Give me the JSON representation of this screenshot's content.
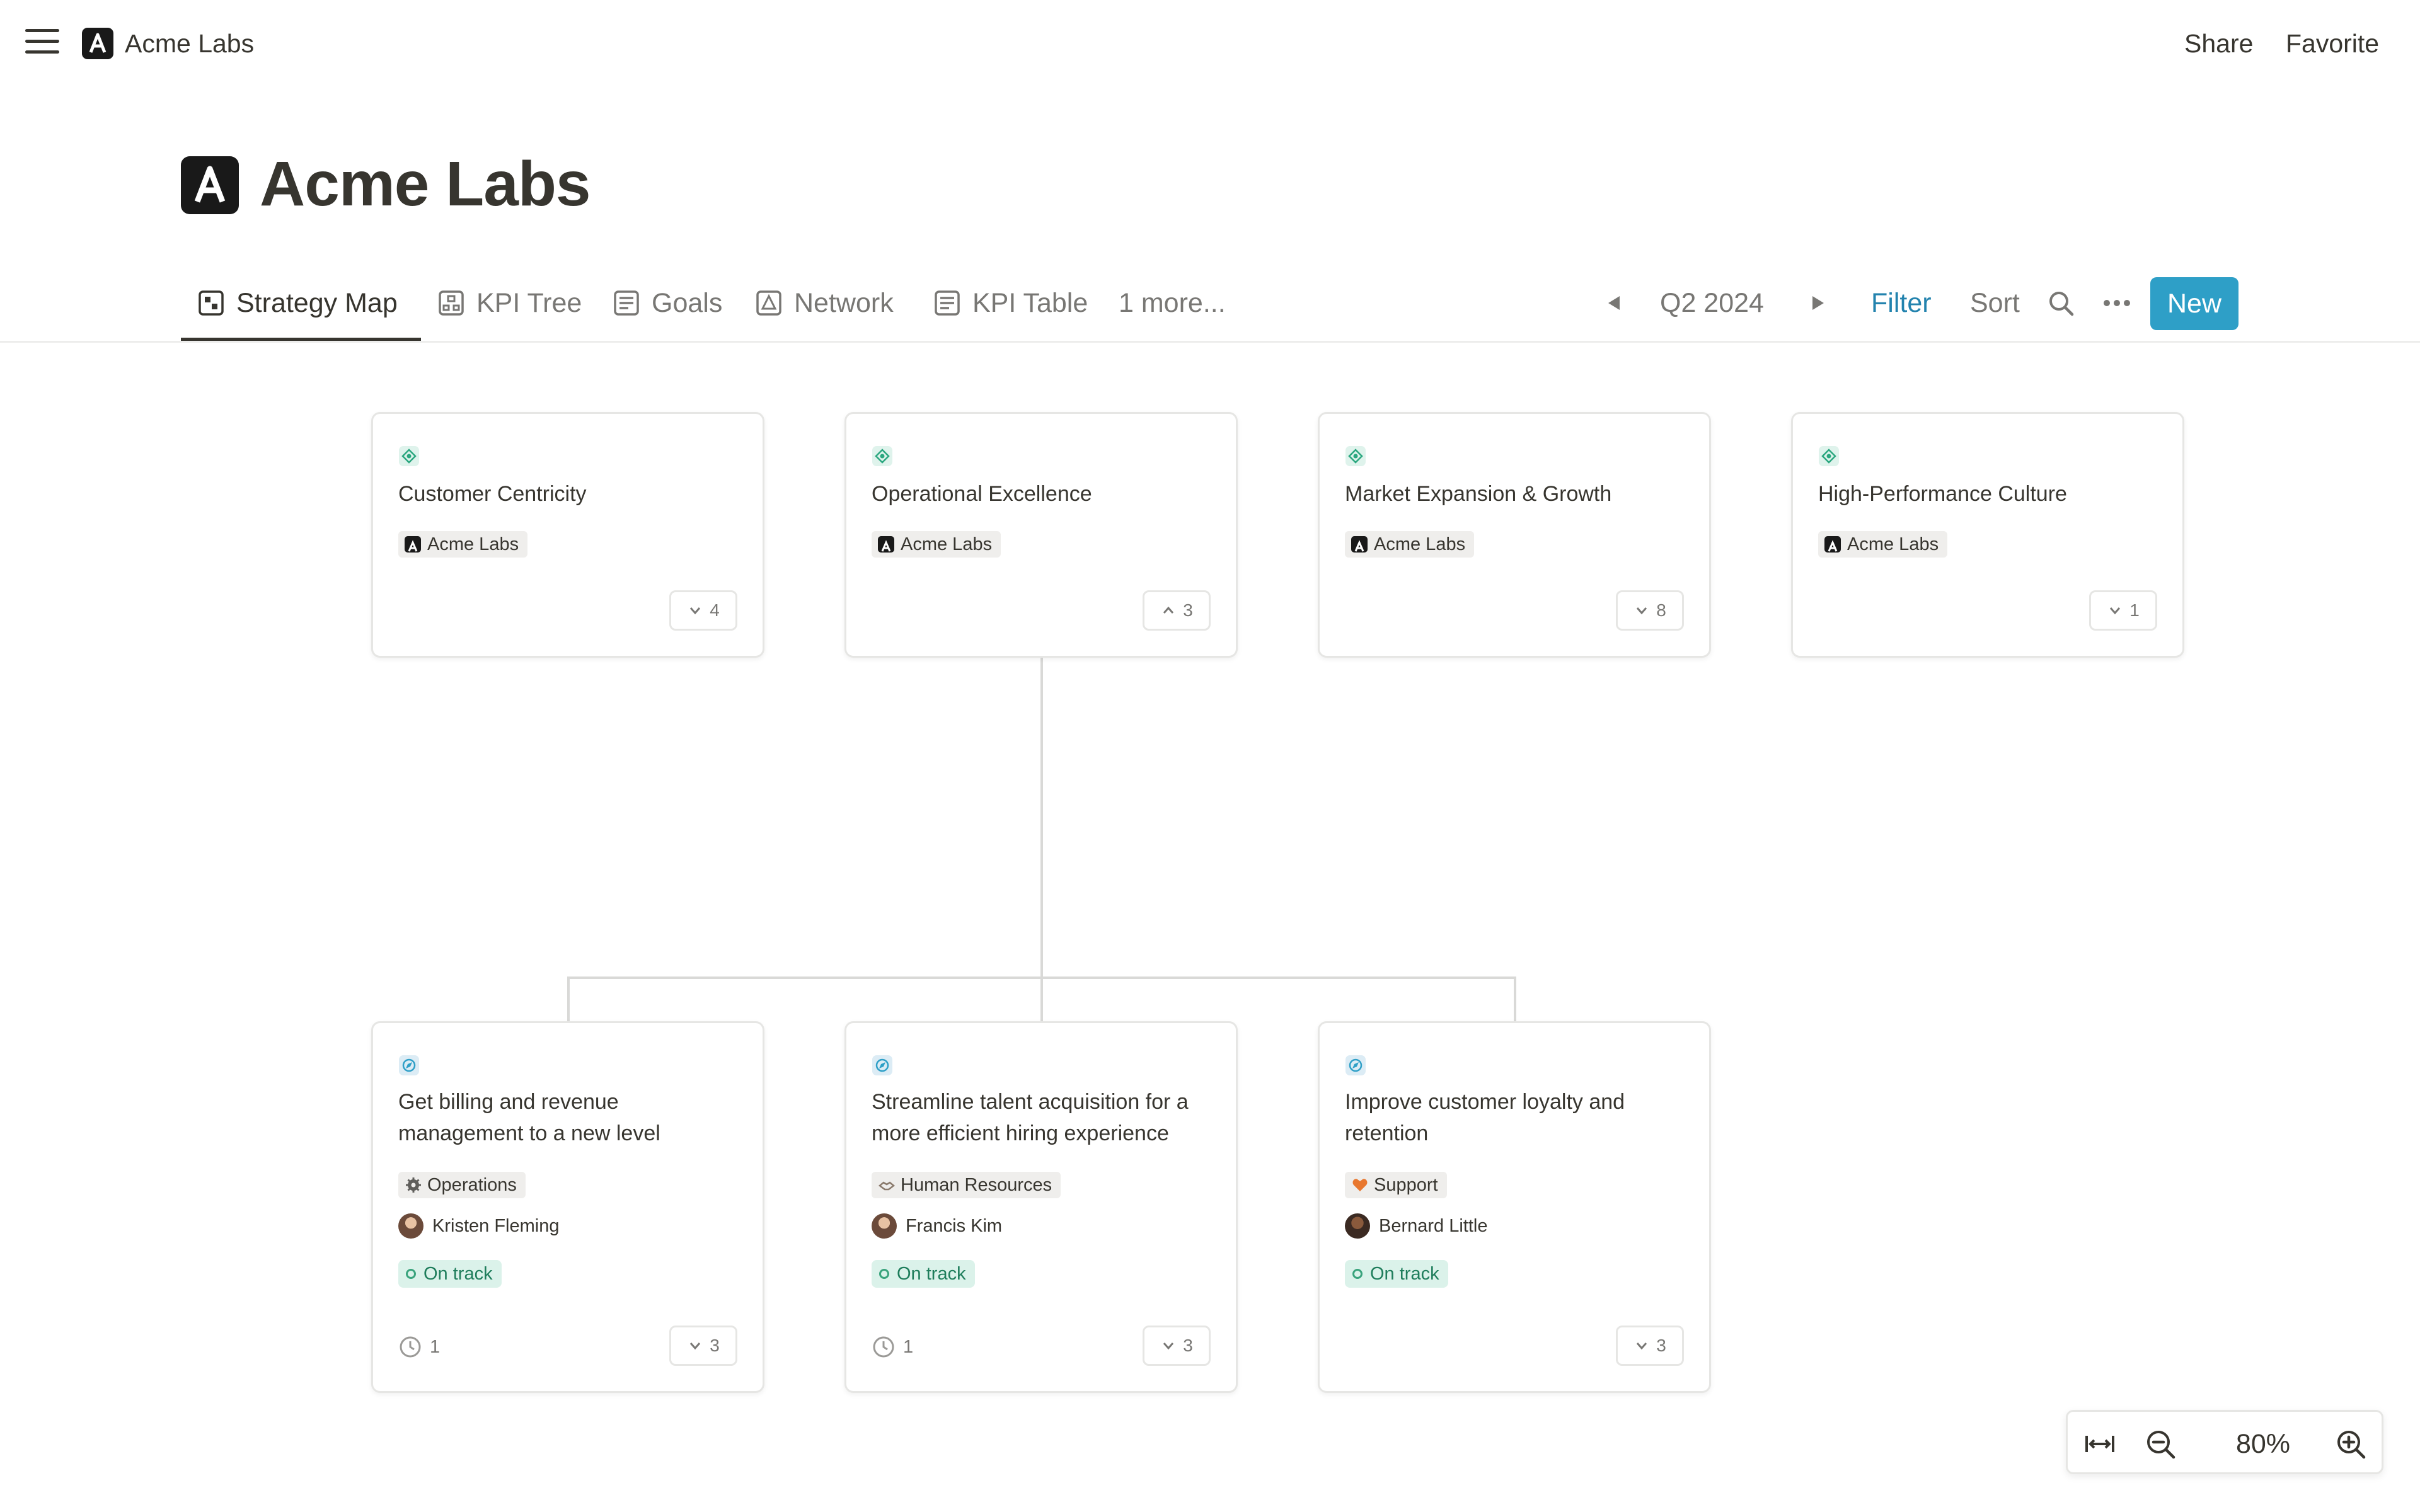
{
  "topbar": {
    "workspace_name": "Acme Labs",
    "share_label": "Share",
    "favorite_label": "Favorite"
  },
  "page": {
    "title": "Acme Labs",
    "logo_letter": "A"
  },
  "tabs": [
    {
      "label": "Strategy Map",
      "icon": "board-icon",
      "active": true
    },
    {
      "label": "KPI Tree",
      "icon": "tree-icon"
    },
    {
      "label": "Goals",
      "icon": "list-icon"
    },
    {
      "label": "Network",
      "icon": "network-icon"
    },
    {
      "label": "KPI Table",
      "icon": "table-icon"
    },
    {
      "label": "1 more..."
    }
  ],
  "controls": {
    "period": "Q2 2024",
    "filter_label": "Filter",
    "sort_label": "Sort",
    "new_label": "New",
    "accent_color": "#2e9fc7"
  },
  "objectives": [
    {
      "title": "Customer Centricity",
      "tag": "Acme Labs",
      "count": "4",
      "chevron": "down"
    },
    {
      "title": "Operational Excellence",
      "tag": "Acme Labs",
      "count": "3",
      "chevron": "up"
    },
    {
      "title": "Market Expansion & Growth",
      "tag": "Acme Labs",
      "count": "8",
      "chevron": "down"
    },
    {
      "title": "High-Performance Culture",
      "tag": "Acme Labs",
      "count": "1",
      "chevron": "down"
    }
  ],
  "goals": [
    {
      "title_line1": "Get billing and revenue",
      "title_line2": "management to a new level",
      "team": "Operations",
      "team_icon": "gear-icon",
      "owner": "Kristen Fleming",
      "status": "On track",
      "updates": "1",
      "count": "3"
    },
    {
      "title_line1": "Streamline talent acquisition for a",
      "title_line2": "more efficient hiring experience",
      "team": "Human Resources",
      "team_icon": "handshake-icon",
      "owner": "Francis Kim",
      "status": "On track",
      "updates": "1",
      "count": "3"
    },
    {
      "title_line1": "Improve customer loyalty and",
      "title_line2": "retention",
      "team": "Support",
      "team_icon": "heart-icon",
      "owner": "Bernard Little",
      "status": "On track",
      "updates": "",
      "count": "3"
    }
  ],
  "zoom": {
    "level": "80%"
  },
  "colors": {
    "objective_icon": "#2aa77f",
    "goal_icon": "#2e9fc7",
    "status_bg": "#dbf2ea",
    "status_text": "#1e7d5b"
  }
}
